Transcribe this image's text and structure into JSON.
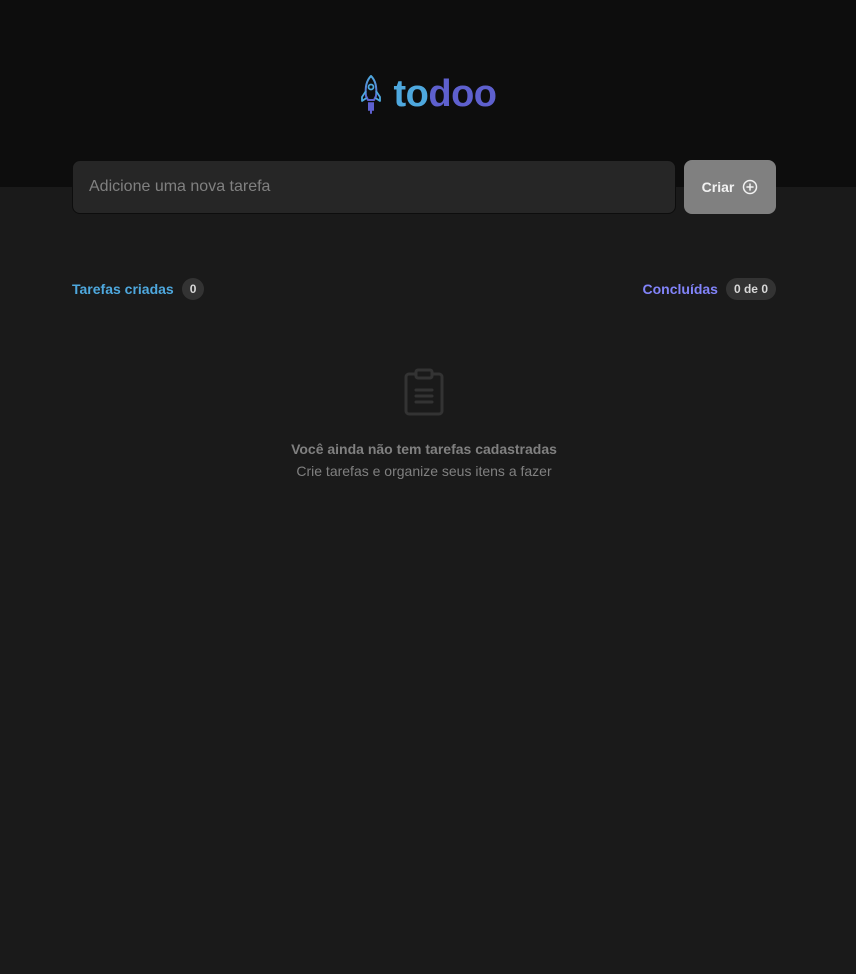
{
  "app": {
    "logo": {
      "text_part1": "to",
      "text_part2": "doo",
      "icon": "rocket-icon"
    }
  },
  "form": {
    "placeholder": "Adicione uma nova tarefa",
    "value": "",
    "create_label": "Criar",
    "create_icon": "plus-circle-icon"
  },
  "counters": {
    "created_label": "Tarefas criadas",
    "created_count": "0",
    "done_label": "Concluídas",
    "done_count": "0 de 0"
  },
  "empty": {
    "icon": "clipboard-icon",
    "title": "Você ainda não tem tarefas cadastradas",
    "subtitle": "Crie tarefas e organize seus itens a fazer"
  },
  "colors": {
    "header_bg": "#0d0d0d",
    "page_bg": "#1a1a1a",
    "input_bg": "#262626",
    "button_bg": "#808080",
    "blue": "#4ea8de",
    "purple_dark": "#5e60ce",
    "purple": "#8284fa",
    "gray_300": "#808080",
    "badge_bg": "#333333"
  }
}
